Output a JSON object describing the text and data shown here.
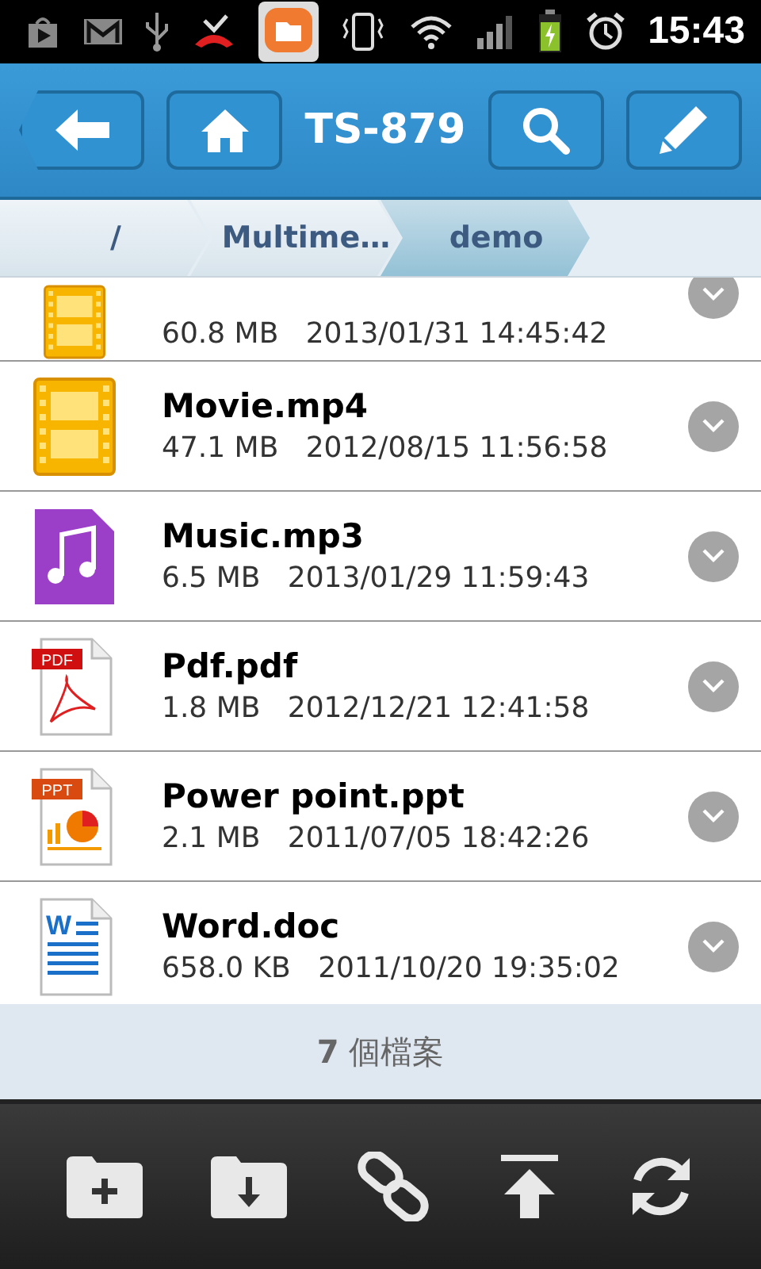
{
  "status_bar": {
    "time": "15:43"
  },
  "header": {
    "title": "TS-879"
  },
  "breadcrumb": [
    {
      "label": "/",
      "selected": false
    },
    {
      "label": "Multime…",
      "selected": false
    },
    {
      "label": "demo",
      "selected": true
    }
  ],
  "files": [
    {
      "kind": "video",
      "meta": "60.8 MB   2013/01/31 14:45:42"
    },
    {
      "kind": "video",
      "name": "Movie.mp4",
      "meta": "47.1 MB   2012/08/15 11:56:58"
    },
    {
      "kind": "audio",
      "name": "Music.mp3",
      "meta": "6.5 MB   2013/01/29 11:59:43"
    },
    {
      "kind": "pdf",
      "badge": "PDF",
      "name": "Pdf.pdf",
      "meta": "1.8 MB   2012/12/21 12:41:58"
    },
    {
      "kind": "ppt",
      "badge": "PPT",
      "name": "Power point.ppt",
      "meta": "2.1 MB   2011/07/05 18:42:26"
    },
    {
      "kind": "doc",
      "badge": "W",
      "name": "Word.doc",
      "meta": "658.0 KB   2011/10/20 19:35:02"
    }
  ],
  "summary": "**7** 個檔案"
}
